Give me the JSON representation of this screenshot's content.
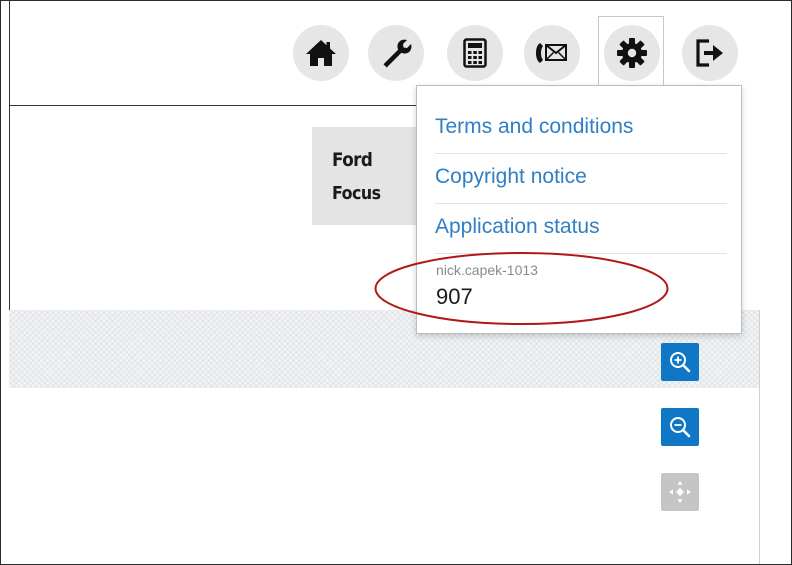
{
  "toolbar": {
    "icons": [
      "home-icon",
      "wrench-icon",
      "calculator-icon",
      "phone-mail-icon",
      "gear-icon",
      "logout-icon"
    ],
    "active": "gear-icon"
  },
  "vehicle": {
    "make": "Ford",
    "model": "Focus"
  },
  "settings_menu": {
    "items": [
      "Terms and conditions",
      "Copyright notice",
      "Application status"
    ],
    "username": "nick.capek-1013",
    "user_number": "907"
  },
  "map_controls": [
    "zoom-in-icon",
    "zoom-out-icon",
    "fit-to-screen-icon"
  ],
  "colors": {
    "link": "#2f7fc4",
    "map_button": "#0f77c5",
    "map_button_disabled": "#c5c5c5",
    "highlight": "#b01818"
  }
}
